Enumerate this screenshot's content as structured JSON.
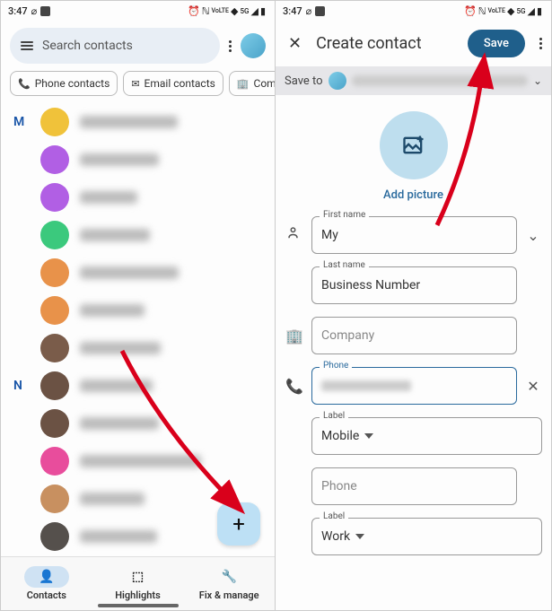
{
  "status": {
    "time": "3:47",
    "volte": "VoLTE",
    "net": "5G"
  },
  "left": {
    "search_placeholder": "Search contacts",
    "chips": {
      "phone": "Phone contacts",
      "email": "Email contacts",
      "company": "Compan"
    },
    "letters": {
      "m": "M",
      "n": "N"
    },
    "contact_count": 12,
    "bottom": {
      "contacts": "Contacts",
      "highlights": "Highlights",
      "fix": "Fix & manage"
    },
    "fab": "+"
  },
  "right": {
    "title": "Create contact",
    "save": "Save",
    "save_to_label": "Save to",
    "add_picture": "Add picture",
    "fields": {
      "first_name_label": "First name",
      "first_name_value": "My",
      "last_name_label": "Last name",
      "last_name_value": "Business Number",
      "company_placeholder": "Company",
      "phone_label": "Phone",
      "label1_label": "Label",
      "label1_value": "Mobile",
      "phone2_placeholder": "Phone",
      "label2_label": "Label",
      "label2_value": "Work"
    }
  },
  "colors": {
    "accent": "#2a6a9d",
    "save_btn": "#1f5f8b",
    "pill": "#bde0f5"
  },
  "avatars": [
    "#f0c23a",
    "#b15fe4",
    "#b15fe4",
    "#3bc97d",
    "#e8924a",
    "#e8924a",
    "#7a5c4a",
    "#6b5244",
    "#6b5244",
    "#e84d9c",
    "#c89060",
    "#55504c"
  ]
}
